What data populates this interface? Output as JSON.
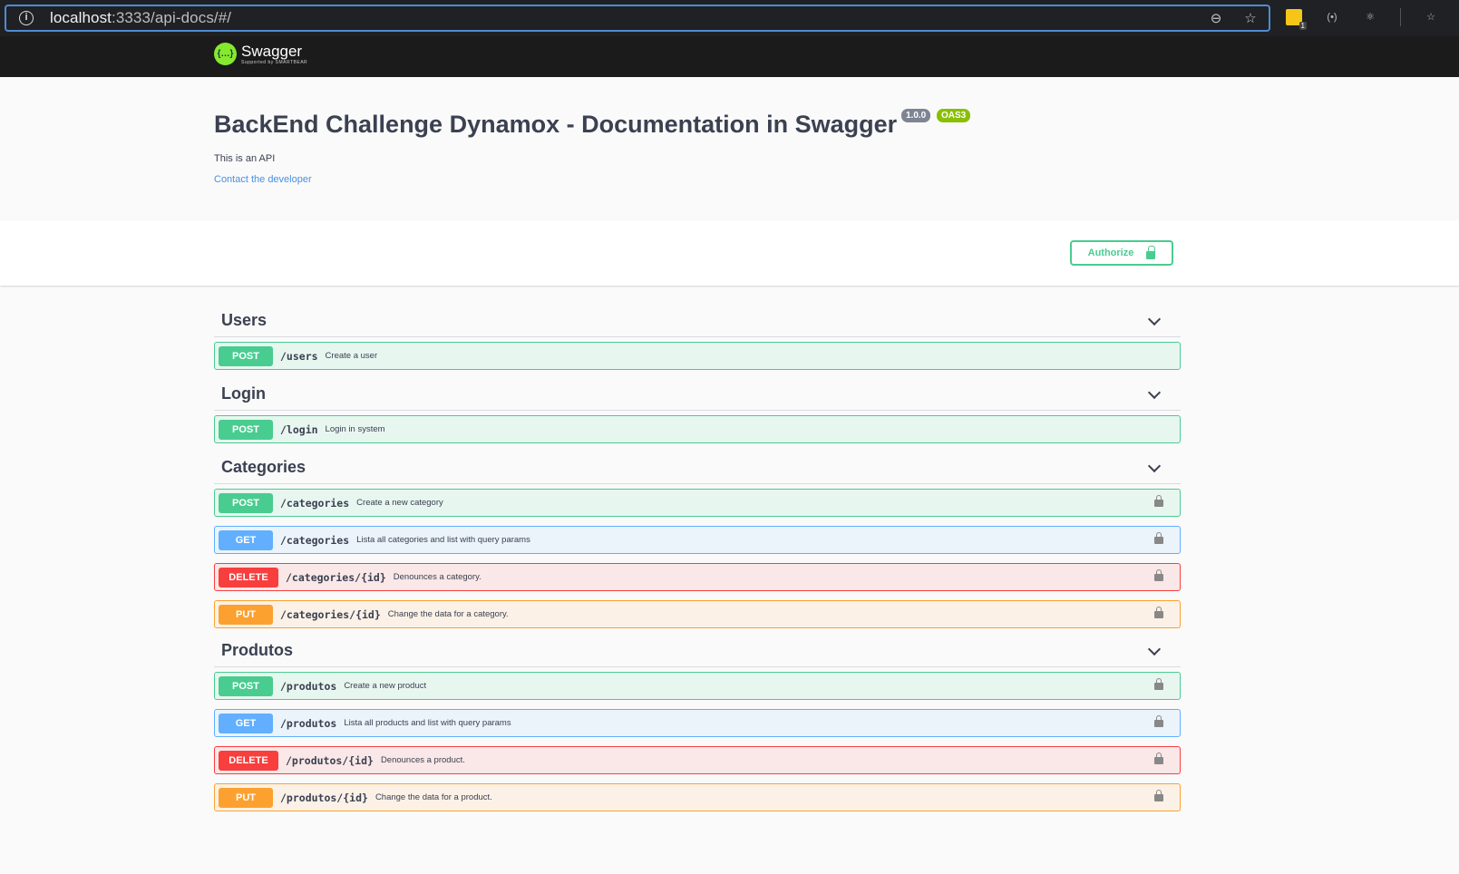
{
  "browser": {
    "url_host": "localhost",
    "url_rest": ":3333/api-docs/#/",
    "sticky_badge": "1"
  },
  "logo": {
    "name": "Swagger",
    "sub": "Supported by SMARTBEAR",
    "mark": "{…}"
  },
  "info": {
    "title": "BackEnd Challenge Dynamox - Documentation in Swagger",
    "version": "1.0.0",
    "oas": "OAS3",
    "description": "This is an API",
    "contact": "Contact the developer"
  },
  "authorize": {
    "label": "Authorize"
  },
  "tags": [
    {
      "name": "Users",
      "ops": [
        {
          "method": "POST",
          "path": "/users",
          "summary": "Create a user",
          "locked": false
        }
      ]
    },
    {
      "name": "Login",
      "ops": [
        {
          "method": "POST",
          "path": "/login",
          "summary": "Login in system",
          "locked": false
        }
      ]
    },
    {
      "name": "Categories",
      "ops": [
        {
          "method": "POST",
          "path": "/categories",
          "summary": "Create a new category",
          "locked": true
        },
        {
          "method": "GET",
          "path": "/categories",
          "summary": "Lista all categories and list with query params",
          "locked": true
        },
        {
          "method": "DELETE",
          "path": "/categories/{id}",
          "summary": "Denounces a category.",
          "locked": true
        },
        {
          "method": "PUT",
          "path": "/categories/{id}",
          "summary": "Change the data for a category.",
          "locked": true
        }
      ]
    },
    {
      "name": "Produtos",
      "ops": [
        {
          "method": "POST",
          "path": "/produtos",
          "summary": "Create a new product",
          "locked": true
        },
        {
          "method": "GET",
          "path": "/produtos",
          "summary": "Lista all products and list with query params",
          "locked": true
        },
        {
          "method": "DELETE",
          "path": "/produtos/{id}",
          "summary": "Denounces a product.",
          "locked": true
        },
        {
          "method": "PUT",
          "path": "/produtos/{id}",
          "summary": "Change the data for a product.",
          "locked": true
        }
      ]
    }
  ]
}
